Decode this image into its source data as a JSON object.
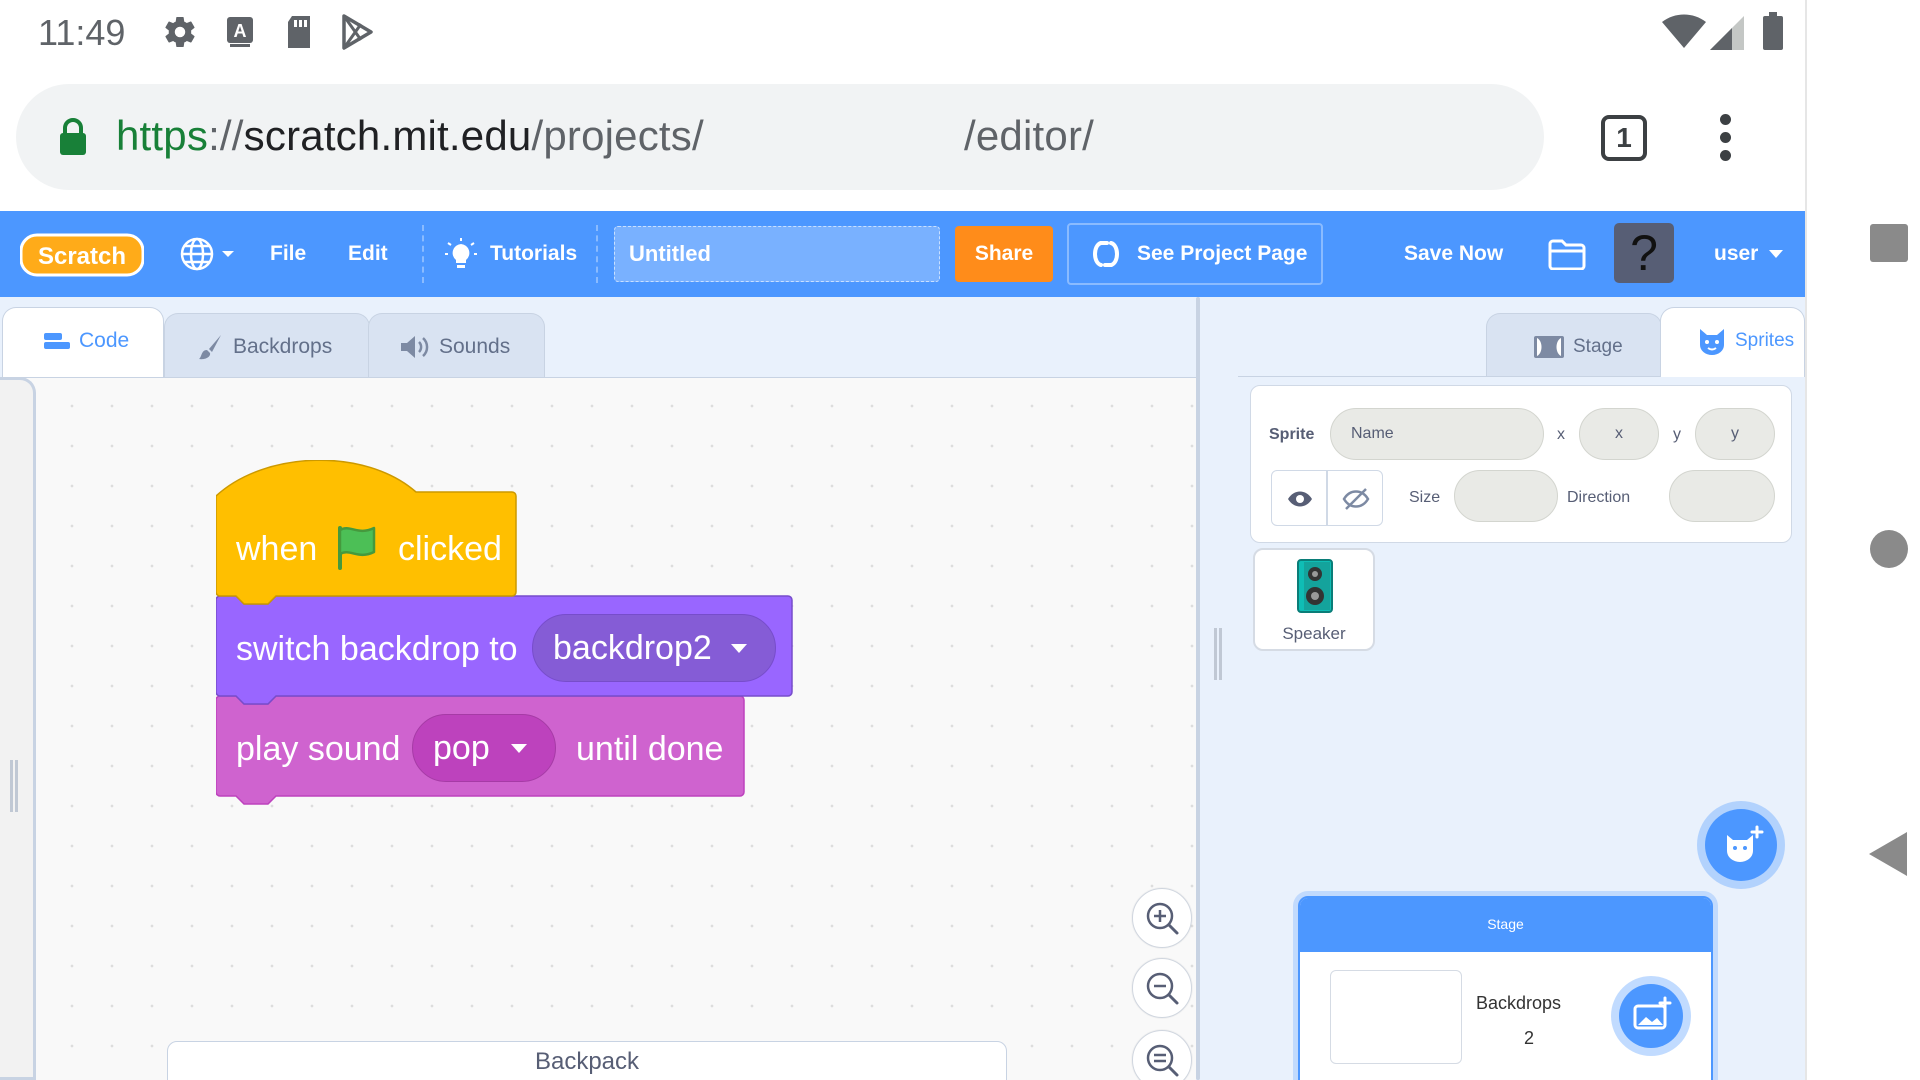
{
  "status_bar": {
    "time": "11:49",
    "icons": [
      "gear-icon",
      "a-icon",
      "sd-card-icon",
      "play-store-icon",
      "wifi-icon",
      "signal-icon",
      "battery-icon"
    ]
  },
  "browser": {
    "url_scheme": "https",
    "url_sep": "://",
    "url_host": "scratch.mit.edu",
    "url_path": "/projects/",
    "url_path_tail": "/editor/",
    "tab_count": "1"
  },
  "menu": {
    "logo": "Scratch",
    "file": "File",
    "edit": "Edit",
    "tutorials": "Tutorials",
    "project_title": "Untitled",
    "share": "Share",
    "see_project_page": "See Project Page",
    "save_now": "Save Now",
    "help": "?",
    "user": "user"
  },
  "tabs": {
    "code": "Code",
    "backdrops": "Backdrops",
    "sounds": "Sounds"
  },
  "blocks": {
    "hat_when": "when",
    "hat_clicked": "clicked",
    "switch_backdrop": "switch backdrop to",
    "backdrop_value": "backdrop2",
    "play_sound": "play sound",
    "sound_value": "pop",
    "until_done": "until done"
  },
  "backpack": "Backpack",
  "stage_tabs": {
    "stage": "Stage",
    "sprites": "Sprites"
  },
  "sprite_info": {
    "sprite_label": "Sprite",
    "name_placeholder": "Name",
    "x_label": "x",
    "x_placeholder": "x",
    "y_label": "y",
    "y_placeholder": "y",
    "size_label": "Size",
    "direction_label": "Direction"
  },
  "sprites": [
    {
      "name": "Speaker"
    }
  ],
  "stage_card": {
    "header": "Stage",
    "backdrops_label": "Backdrops",
    "backdrops_count": "2"
  },
  "colors": {
    "scratch_blue": "#4c97ff",
    "share_orange": "#ff8c1a",
    "events_yellow": "#ffbf00",
    "looks_purple": "#9966ff",
    "sound_magenta": "#cf63cf",
    "url_green": "#188038"
  }
}
